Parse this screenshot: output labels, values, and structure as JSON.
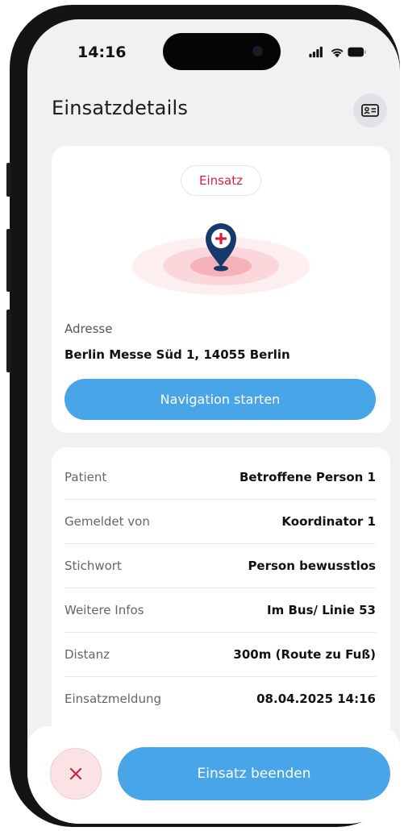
{
  "status_bar": {
    "time": "14:16",
    "icons": [
      "signal-icon",
      "wifi-icon",
      "battery-icon"
    ]
  },
  "header": {
    "title": "Einsatzdetails",
    "action_icon": "id-card-icon"
  },
  "location_card": {
    "badge": "Einsatz",
    "address_label": "Adresse",
    "address": "Berlin Messe Süd 1, 14055 Berlin",
    "navigation_button": "Navigation starten"
  },
  "details": [
    {
      "label": "Patient",
      "value": "Betroffene Person 1"
    },
    {
      "label": "Gemeldet von",
      "value": "Koordinator 1"
    },
    {
      "label": "Stichwort",
      "value": "Person bewusstlos"
    },
    {
      "label": "Weitere Infos",
      "value": "Im Bus/ Linie 53"
    },
    {
      "label": "Distanz",
      "value": "300m (Route zu Fuß)"
    },
    {
      "label": "Einsatzmeldung",
      "value": "08.04.2025 14:16"
    }
  ],
  "footer": {
    "close_icon": "close-icon",
    "end_button": "Einsatz beenden"
  },
  "colors": {
    "accent_blue": "#48a6e8",
    "emergency_red": "#d8203a",
    "pin_navy": "#163a6b",
    "background": "#f1f1f3"
  }
}
